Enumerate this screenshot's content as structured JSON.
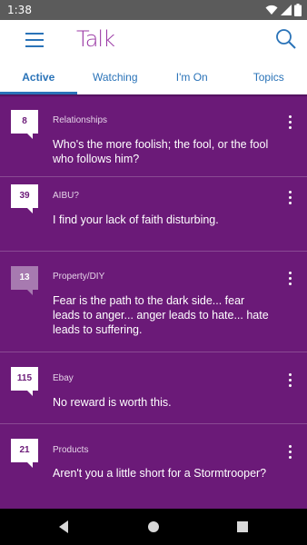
{
  "status_bar": {
    "time": "1:38",
    "icons": [
      "wifi-icon",
      "signal-icon",
      "battery-icon"
    ]
  },
  "app_bar": {
    "logo": "Talk",
    "menu_icon": "hamburger-menu-icon",
    "search_icon": "search-icon"
  },
  "tabs": [
    {
      "label": "Active",
      "active": true
    },
    {
      "label": "Watching",
      "active": false
    },
    {
      "label": "I'm On",
      "active": false
    },
    {
      "label": "Topics",
      "active": false
    }
  ],
  "threads": [
    {
      "count": "8",
      "category": "Relationships",
      "title": "Who's the more foolish; the fool, or the fool who follows him?",
      "read": false
    },
    {
      "count": "39",
      "category": "AIBU?",
      "title": "I find your lack of faith disturbing.",
      "read": false
    },
    {
      "count": "13",
      "category": "Property/DIY",
      "title": "Fear is the path to the dark side... fear leads to anger... anger leads to hate... hate leads to suffering.",
      "read": true
    },
    {
      "count": "115",
      "category": "Ebay",
      "title": "No reward is worth this.",
      "read": false
    },
    {
      "count": "21",
      "category": "Products",
      "title": "Aren't you a little short for a Stormtrooper?",
      "read": false
    }
  ],
  "colors": {
    "primary": "#6b1a78",
    "accent": "#2a73b8",
    "logo": "#9b3aa5"
  },
  "nav_bar": {
    "icons": [
      "back-icon",
      "home-icon",
      "recents-icon"
    ]
  }
}
